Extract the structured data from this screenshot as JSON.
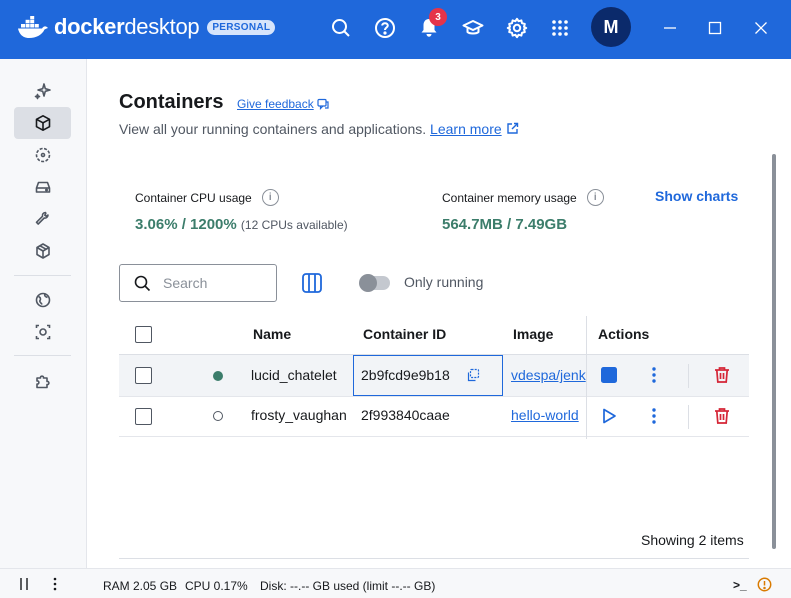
{
  "app": {
    "logo_word1": "docker",
    "logo_word2": "desktop",
    "plan_badge": "PERSONAL",
    "notification_count": "3",
    "avatar_initial": "M"
  },
  "colors": {
    "brand": "#1f68db",
    "running": "#3c7d6b",
    "danger": "#d52536"
  },
  "sidebar": {
    "items": [
      {
        "name": "ask-gordon",
        "icon": "sparkle-icon",
        "active": false
      },
      {
        "name": "containers",
        "icon": "container-icon",
        "active": true
      },
      {
        "name": "images",
        "icon": "image-icon",
        "active": false
      },
      {
        "name": "volumes",
        "icon": "drive-icon",
        "active": false
      },
      {
        "name": "builds",
        "icon": "wrench-icon",
        "active": false
      },
      {
        "name": "models",
        "icon": "cube-icon",
        "active": false
      },
      {
        "name": "docker-hub",
        "icon": "globe-icon",
        "active": false
      },
      {
        "name": "docker-scout",
        "icon": "scout-icon",
        "active": false
      },
      {
        "name": "extensions",
        "icon": "puzzle-icon",
        "active": false
      }
    ]
  },
  "page": {
    "title": "Containers",
    "feedback": "Give feedback",
    "subtitle": "View all your running containers and applications.",
    "learn_more": "Learn more"
  },
  "stats": {
    "cpu_label": "Container CPU usage",
    "cpu_value": "3.06% / 1200%",
    "cpu_note": "(12 CPUs available)",
    "mem_label": "Container memory usage",
    "mem_value": "564.7MB / 7.49GB",
    "show_charts": "Show charts"
  },
  "toolbar": {
    "search_placeholder": "Search",
    "only_running": "Only running"
  },
  "table": {
    "headers": {
      "name": "Name",
      "container_id": "Container ID",
      "image": "Image",
      "actions": "Actions"
    },
    "rows": [
      {
        "name": "lucid_chatelet",
        "container_id": "2b9fcd9e9b18",
        "image": "vdespa/jenk",
        "status": "running"
      },
      {
        "name": "frosty_vaughan",
        "container_id": "2f993840caae",
        "image": "hello-world",
        "status": "stopped"
      }
    ],
    "showing": "Showing 2 items"
  },
  "statusbar": {
    "ram": "RAM 2.05 GB",
    "cpu": "CPU 0.17%",
    "disk": "Disk: --.-- GB used (limit --.-- GB)",
    "terminal": ">_"
  }
}
